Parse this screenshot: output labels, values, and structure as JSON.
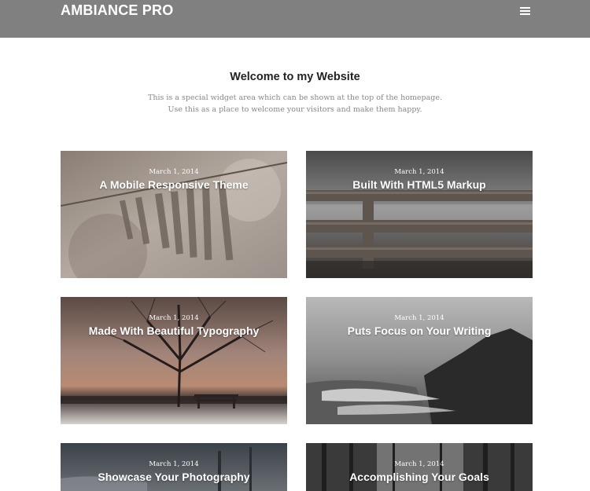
{
  "header": {
    "site_title": "AMBIANCE PRO",
    "menu_icon": "hamburger-menu-icon",
    "background_color": "#808080"
  },
  "welcome": {
    "title": "Welcome to my Website",
    "line1": "This is a special widget area which can be shown at the top of the homepage.",
    "line2": "Use this as a place to welcome your visitors and make them happy."
  },
  "posts": [
    {
      "date": "March 1, 2014",
      "title": "A Mobile Responsive Theme"
    },
    {
      "date": "March 1, 2014",
      "title": "Built With HTML5 Markup"
    },
    {
      "date": "March 1, 2014",
      "title": "Made With Beautiful Typography"
    },
    {
      "date": "March 1, 2014",
      "title": "Puts Focus on Your Writing"
    },
    {
      "date": "March 1, 2014",
      "title": "Showcase Your Photography"
    },
    {
      "date": "March 1, 2014",
      "title": "Accomplishing Your Goals"
    }
  ]
}
